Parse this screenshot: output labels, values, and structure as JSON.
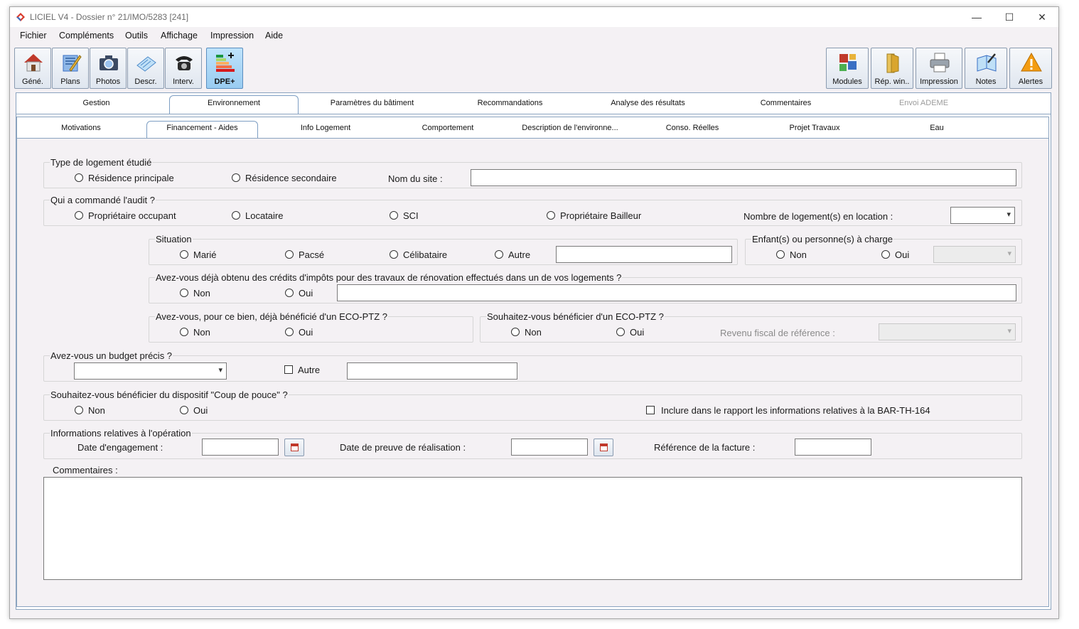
{
  "window": {
    "title": "LICIEL V4 - Dossier n° 21/IMO/5283 [241]",
    "controls": {
      "minimize": "—",
      "maximize": "☐",
      "close": "✕"
    }
  },
  "menu": [
    "Fichier",
    "Compléments",
    "Outils",
    "Affichage",
    "Impression",
    "Aide"
  ],
  "toolbar_left": [
    {
      "label": "Géné.",
      "icon": "house-icon"
    },
    {
      "label": "Plans",
      "icon": "plans-icon"
    },
    {
      "label": "Photos",
      "icon": "camera-icon"
    },
    {
      "label": "Descr.",
      "icon": "description-icon"
    },
    {
      "label": "Interv.",
      "icon": "phone-icon"
    },
    {
      "label": "DPE+",
      "icon": "dpe-icon"
    }
  ],
  "toolbar_right": [
    {
      "label": "Modules",
      "icon": "puzzle-icon"
    },
    {
      "label": "Rép. win..",
      "icon": "folder-icon"
    },
    {
      "label": "Impression",
      "icon": "printer-icon"
    },
    {
      "label": "Notes",
      "icon": "notes-icon"
    },
    {
      "label": "Alertes",
      "icon": "warning-icon"
    }
  ],
  "main_tabs": [
    "Gestion",
    "Environnement",
    "Paramètres du bâtiment",
    "Recommandations",
    "Analyse des résultats",
    "Commentaires",
    "Envoi ADEME"
  ],
  "sub_tabs": [
    "Motivations",
    "Financement  - Aides",
    "Info Logement",
    "Comportement",
    "Description de l'environne...",
    "Conso. Réelles",
    "Projet Travaux",
    "Eau"
  ],
  "form": {
    "type_logement": {
      "legend": "Type de logement étudié",
      "opt1": "Résidence principale",
      "opt2": "Résidence secondaire",
      "site_label": "Nom du site :",
      "site_value": ""
    },
    "commande": {
      "legend": "Qui a commandé l'audit ?",
      "opt1": "Propriétaire occupant",
      "opt2": "Locataire",
      "opt3": "SCI",
      "opt4": "Propriétaire Bailleur",
      "nb_label": "Nombre de logement(s) en location :",
      "nb_value": ""
    },
    "situation": {
      "legend": "Situation",
      "opt1": "Marié",
      "opt2": "Pacsé",
      "opt3": "Célibataire",
      "opt4": "Autre",
      "autre_value": ""
    },
    "enfants": {
      "legend": "Enfant(s) ou personne(s) à charge",
      "opt1": "Non",
      "opt2": "Oui",
      "count": ""
    },
    "credits": {
      "legend": "Avez-vous déjà obtenu des crédits d'impôts pour des travaux de rénovation effectués dans un de vos logements ?",
      "opt1": "Non",
      "opt2": "Oui",
      "detail": ""
    },
    "ecoptz_bien": {
      "legend": "Avez-vous, pour ce bien, déjà bénéficié d'un ECO-PTZ ?",
      "opt1": "Non",
      "opt2": "Oui"
    },
    "ecoptz_souhait": {
      "legend": "Souhaitez-vous bénéficier d'un ECO-PTZ ?",
      "opt1": "Non",
      "opt2": "Oui",
      "revenu_label": "Revenu fiscal de référence :",
      "revenu_value": ""
    },
    "budget": {
      "legend": "Avez-vous un budget précis ?",
      "select_value": "",
      "autre_label": "Autre",
      "autre_value": ""
    },
    "coup_de_pouce": {
      "legend": "Souhaitez-vous bénéficier du dispositif \"Coup de pouce\" ?",
      "opt1": "Non",
      "opt2": "Oui",
      "inclure_label": "Inclure dans le rapport les informations relatives à la BAR-TH-164"
    },
    "operation": {
      "legend": "Informations relatives à l'opération",
      "date_engagement_label": "Date d'engagement :",
      "date_engagement_value": "",
      "date_preuve_label": "Date de preuve de réalisation :",
      "date_preuve_value": "",
      "ref_facture_label": "Référence de la facture :",
      "ref_facture_value": ""
    },
    "commentaires": {
      "label": "Commentaires :",
      "value": ""
    }
  }
}
